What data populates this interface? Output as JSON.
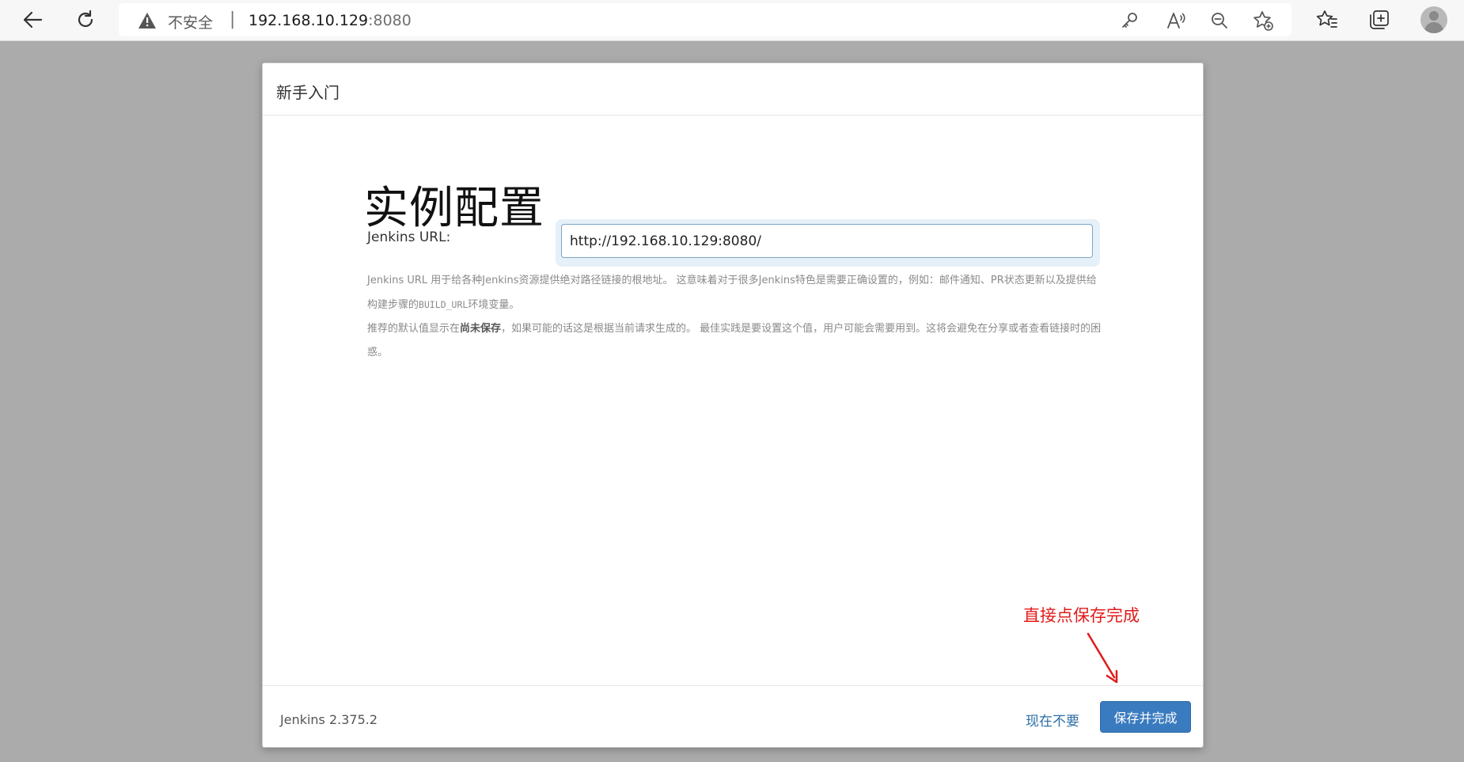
{
  "browser": {
    "security_label": "不安全",
    "separator": "|",
    "url_host": "192.168.10.129",
    "url_port": ":8080"
  },
  "dialog": {
    "title": "新手入门",
    "heading": "实例配置",
    "url_label": "Jenkins URL:",
    "url_value": "http://192.168.10.129:8080/",
    "help": {
      "line1_a": "Jenkins URL 用于给各种Jenkins资源提供绝对路径链接的根地址。 这意味着对于很多Jenkins特色是需要正确设置的，例如：邮件通知、PR状态更新以及提供给构建步骤的",
      "line1_code": "BUILD_URL",
      "line1_b": "环境变量。",
      "line2_a": "推荐的默认值显示在",
      "line2_bold": "尚未保存",
      "line2_b": "，如果可能的话这是根据当前请求生成的。 最佳实践是要设置这个值，用户可能会需要用到。这将会避免在分享或者查看链接时的困惑。"
    },
    "annotation": "直接点保存完成",
    "footer": {
      "version": "Jenkins 2.375.2",
      "skip_label": "现在不要",
      "save_label": "保存并完成"
    }
  },
  "colors": {
    "primary_button": "#3a7bbf",
    "link": "#2d6ea7",
    "annotation": "#e11b1b"
  }
}
